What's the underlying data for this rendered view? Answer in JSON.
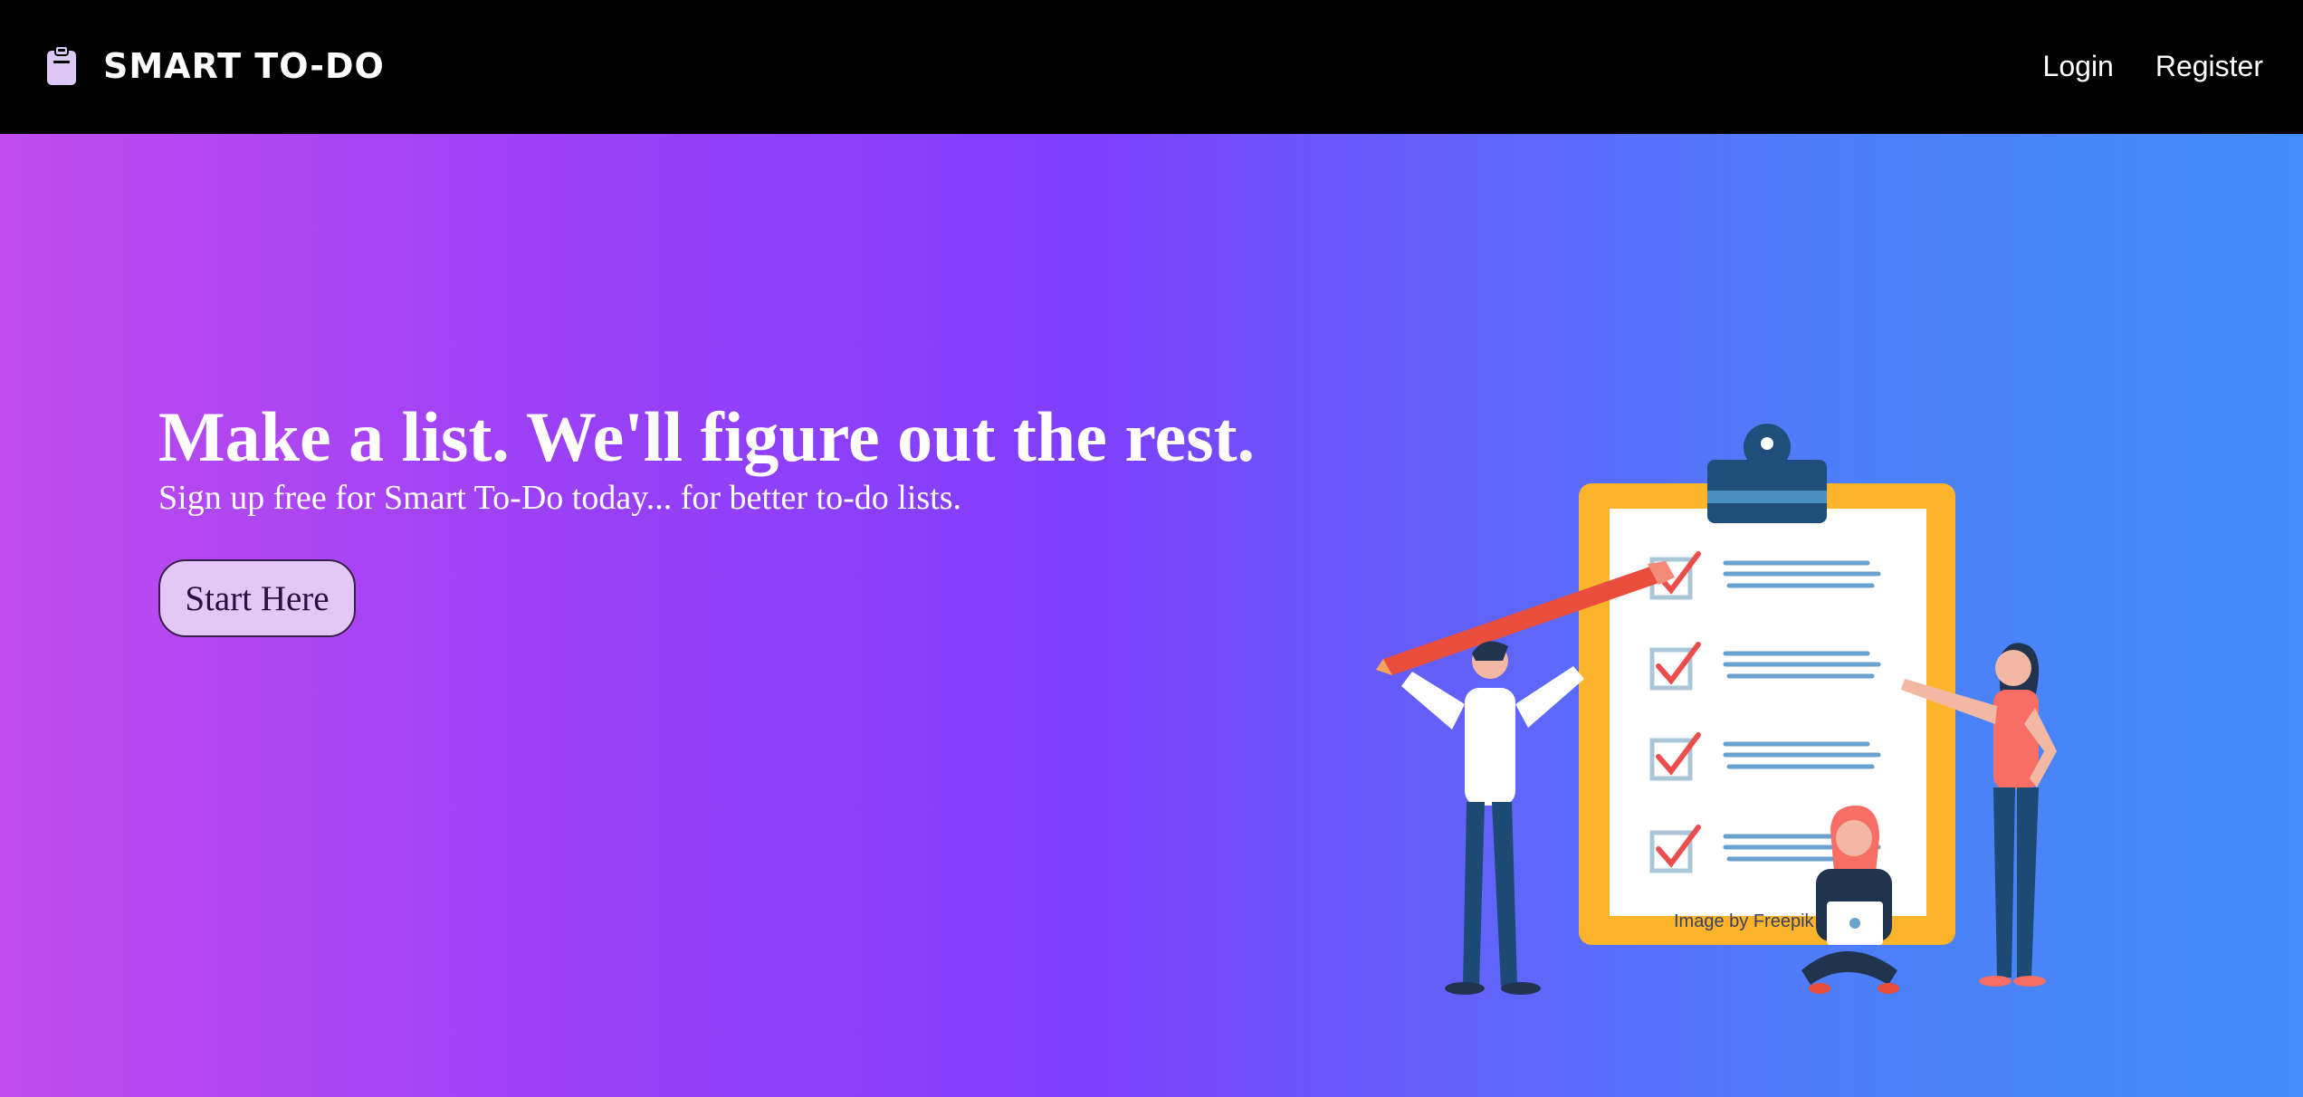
{
  "navbar": {
    "brand": {
      "icon": "clipboard-icon",
      "title": "SMART TO-DO"
    },
    "links": {
      "login": "Login",
      "register": "Register"
    }
  },
  "hero": {
    "headline": "Make a list. We'll figure out the rest.",
    "subhead": "Sign up free for Smart To-Do today... for better to-do lists.",
    "cta_label": "Start Here",
    "illustration": {
      "icon": "checklist-clipboard-illustration",
      "checked_items": 4
    },
    "credit": "Image by Freepik"
  },
  "colors": {
    "navbar_bg": "#000000",
    "gradient_start": "#c04ced",
    "gradient_mid": "#7f3ffd",
    "gradient_end": "#428df8",
    "button_bg": "#e3c8f6",
    "clipboard_frame": "#fbb42b",
    "clipboard_clip": "#1f4e7a",
    "check_color": "#ec4e4e"
  }
}
